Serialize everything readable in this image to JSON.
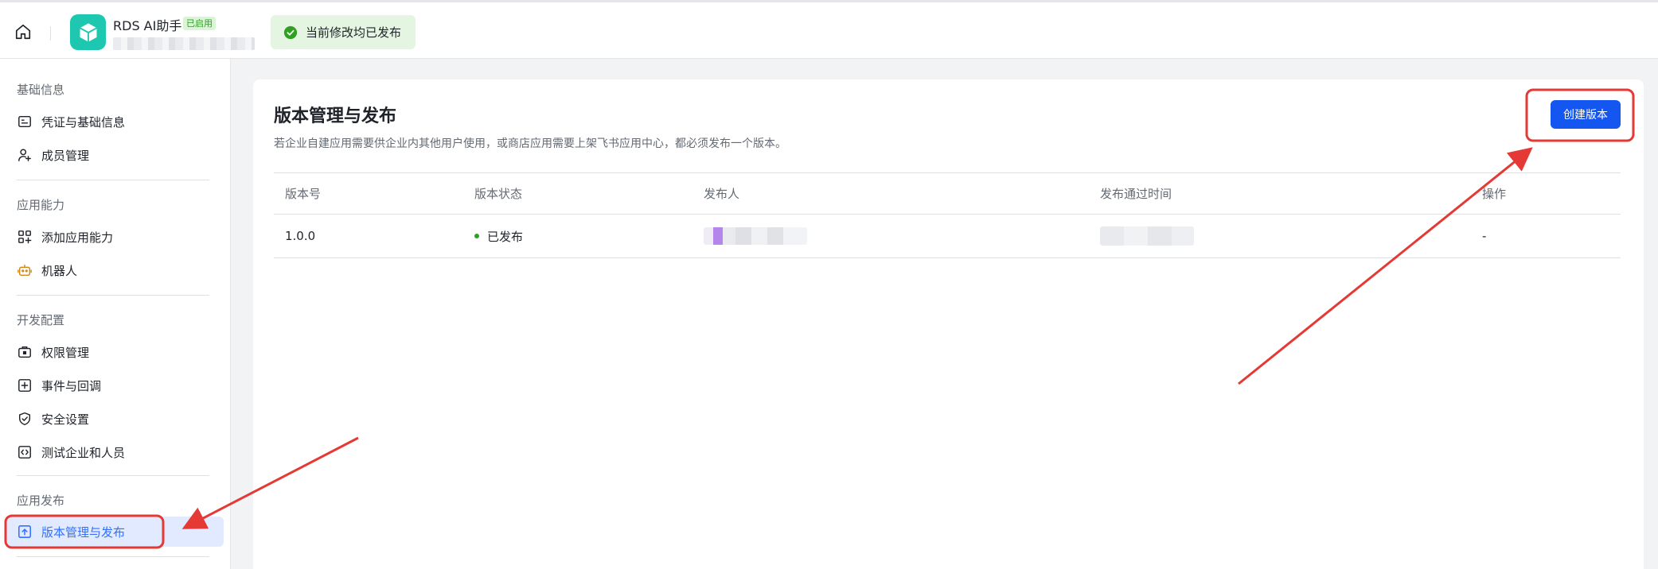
{
  "header": {
    "app_name": "RDS AI助手",
    "app_badge": "已启用",
    "toast": "当前修改均已发布"
  },
  "sidebar": {
    "sections": [
      {
        "title": "基础信息",
        "items": [
          {
            "label": "凭证与基础信息",
            "icon": "credential-icon"
          },
          {
            "label": "成员管理",
            "icon": "user-add-icon"
          }
        ]
      },
      {
        "title": "应用能力",
        "items": [
          {
            "label": "添加应用能力",
            "icon": "grid-add-icon"
          },
          {
            "label": "机器人",
            "icon": "robot-icon"
          }
        ]
      },
      {
        "title": "开发配置",
        "items": [
          {
            "label": "权限管理",
            "icon": "briefcase-lock-icon"
          },
          {
            "label": "事件与回调",
            "icon": "event-callback-icon"
          },
          {
            "label": "安全设置",
            "icon": "shield-check-icon"
          },
          {
            "label": "测试企业和人员",
            "icon": "code-box-icon"
          }
        ]
      },
      {
        "title": "应用发布",
        "items": [
          {
            "label": "版本管理与发布",
            "icon": "upload-box-icon"
          }
        ]
      }
    ]
  },
  "main": {
    "title": "版本管理与发布",
    "description": "若企业自建应用需要供企业内其他用户使用，或商店应用需要上架飞书应用中心，都必须发布一个版本。",
    "create_button": "创建版本",
    "table": {
      "columns": [
        "版本号",
        "版本状态",
        "发布人",
        "发布通过时间",
        "操作"
      ],
      "rows": [
        {
          "version": "1.0.0",
          "status": "已发布",
          "action": "-"
        }
      ]
    }
  },
  "colors": {
    "accent": "#1456f0",
    "active_bg": "#e1eaff",
    "success": "#2ea121",
    "annotation": "#e53935"
  }
}
